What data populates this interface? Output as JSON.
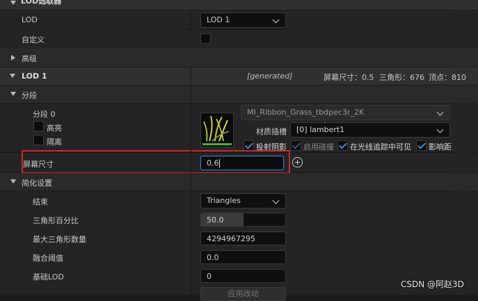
{
  "top_section": {
    "title": "LOD选取器"
  },
  "lod_picker": {
    "label": "LOD",
    "value": "LOD 1"
  },
  "custom": {
    "label": "自定义"
  },
  "advanced": {
    "label": "高级"
  },
  "lod1_header": {
    "title": "LOD 1",
    "generated": "[generated]",
    "screen_size": "屏幕尺寸：0.5",
    "triangles": "三角形：676",
    "vertices": "顶点：810"
  },
  "sections": {
    "label": "分段"
  },
  "section0": {
    "label": "分段 0",
    "highlight": "高亮",
    "isolate": "隔离",
    "material": "MI_Ribbon_Grass_tbdpec3r_2K",
    "slot_label": "材质插槽",
    "slot_value": "[0] lambert1",
    "cast_shadow": "投射阴影",
    "enable_collision": "启用碰撞",
    "visible_in_raytracing": "在光线追踪中可见",
    "affect_distance": "影响距"
  },
  "screen_size_row": {
    "label": "屏幕尺寸",
    "value": "0.6",
    "add_icon": "plus-circle-icon"
  },
  "reduction": {
    "label": "简化设置",
    "termination_label": "结束",
    "termination_value": "Triangles",
    "tri_percent_label": "三角形百分比",
    "tri_percent_value": "50.0",
    "tri_percent_fill": 0.5,
    "max_tri_label": "最大三角形数量",
    "max_tri_value": "4294967295",
    "weld_label": "融合阈值",
    "weld_value": "0.0",
    "base_lod_label": "基础LOD",
    "base_lod_value": "0",
    "apply_label": "应用改动"
  },
  "watermark": "CSDN @阿赵3D",
  "colors": {
    "highlight_box": "#d0282e",
    "accent": "#2f8ed8",
    "green_bar": "#3fb43f"
  }
}
